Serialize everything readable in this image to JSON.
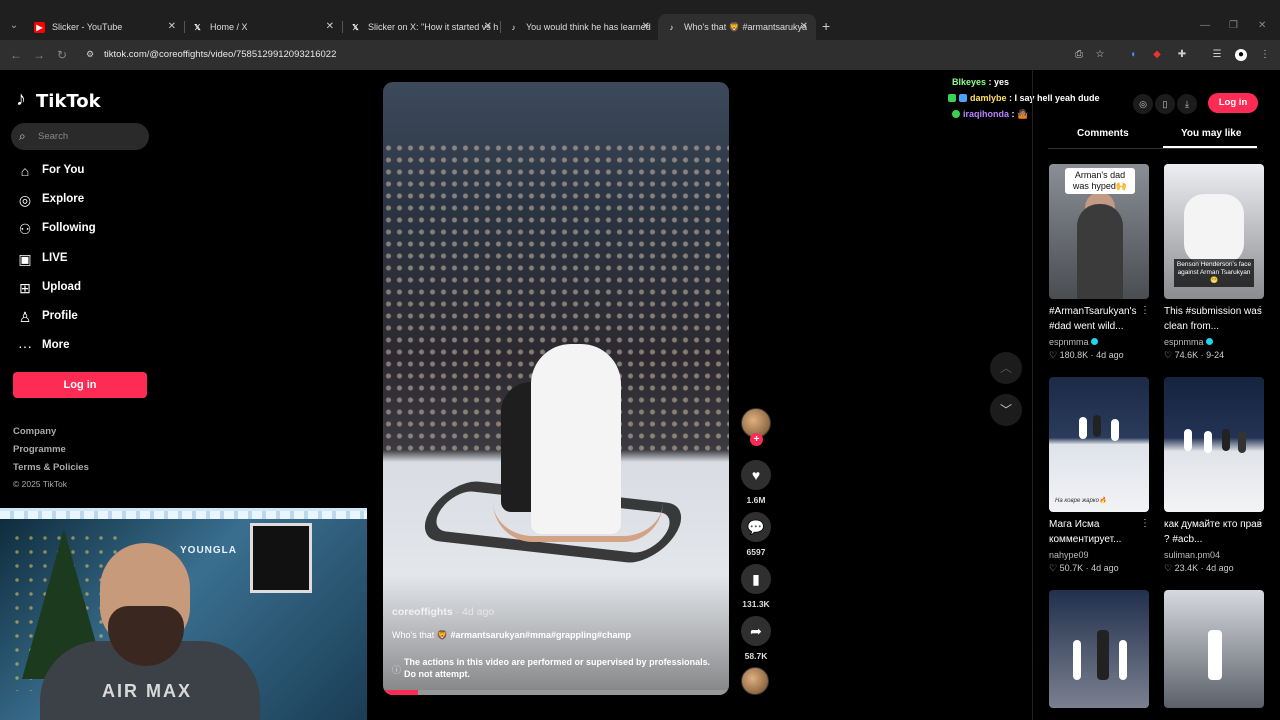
{
  "browser": {
    "tabs": [
      {
        "title": "Slicker - YouTube",
        "icon": "youtube-icon",
        "color": "#ff0000"
      },
      {
        "title": "Home / X",
        "icon": "x-icon",
        "color": "#ffffff"
      },
      {
        "title": "Slicker on X: \"How it started vs h",
        "icon": "x-icon",
        "color": "#ffffff"
      },
      {
        "title": "You would think he has learned",
        "icon": "tiktok-icon",
        "color": "#ffffff"
      },
      {
        "title": "Who's that 🦁 #armantsarukya",
        "icon": "tiktok-icon",
        "color": "#ffffff"
      }
    ],
    "active_tab": 4,
    "url": "tiktok.com/@coreoffights/video/7585129912093216022"
  },
  "tiktok": {
    "logo_text": "TikTok",
    "search_placeholder": "Search",
    "nav": [
      {
        "label": "For You",
        "icon": "home-icon",
        "glyph": "⌂"
      },
      {
        "label": "Explore",
        "icon": "compass-icon",
        "glyph": "◎"
      },
      {
        "label": "Following",
        "icon": "people-icon",
        "glyph": "⚇"
      },
      {
        "label": "LIVE",
        "icon": "live-icon",
        "glyph": "▣"
      },
      {
        "label": "Upload",
        "icon": "upload-icon",
        "glyph": "⊞"
      },
      {
        "label": "Profile",
        "icon": "profile-icon",
        "glyph": "♙"
      },
      {
        "label": "More",
        "icon": "more-icon",
        "glyph": "···"
      }
    ],
    "login_label": "Log in",
    "footer": {
      "company": "Company",
      "programme": "Programme",
      "terms": "Terms & Policies",
      "copyright": "© 2025 TikTok"
    },
    "accent": "#fe2c55"
  },
  "webcam": {
    "logo": "YOUNGLA",
    "shirt_text": "AIR MAX"
  },
  "video": {
    "author": "coreoffights",
    "age": "· 4d ago",
    "caption_prefix": "Who's that 🦁 ",
    "caption_tags": "#armantsarukyan#mma#grappling#champ",
    "warning": "The actions in this video are performed or supervised by professionals. Do not attempt.",
    "progress": 0.1,
    "likes": "1.6M",
    "comments": "6597",
    "saves": "131.3K",
    "shares": "58.7K"
  },
  "chat": [
    {
      "user": "Blkeyes",
      "message": " : yes",
      "color": "#8fff8f"
    },
    {
      "user": "damlybe",
      "message": " : I say hell yeah dude",
      "color": "#ffe066"
    },
    {
      "user": "iraqihonda",
      "message": " : 🤷🏽",
      "color": "#b583ff"
    }
  ],
  "right_panel": {
    "login_label": "Log in",
    "tab_comments": "Comments",
    "tab_you_may_like": "You may like",
    "cards": [
      {
        "thumb_label": "Arman's dad was hyped🙌",
        "title": "#ArmanTsarukyan's #dad went wild...",
        "author": "espnmma",
        "verified": true,
        "likes": "180.8K",
        "age": "4d ago"
      },
      {
        "thumb_label": "Benson Henderson's face against Arman Tsarukyan 😬",
        "title": "This #submission was clean from...",
        "author": "espnmma",
        "verified": true,
        "likes": "74.6K",
        "age": "9-24"
      },
      {
        "thumb_label": "На ковре жарко🔥",
        "title": "Мага Исма комментирует...",
        "author": "nahype09",
        "verified": false,
        "likes": "50.7K",
        "age": "4d ago"
      },
      {
        "thumb_label": "",
        "title": "как думайте кто прав ? #acb...",
        "author": "suliman.pm04",
        "verified": false,
        "likes": "23.4K",
        "age": "4d ago"
      }
    ]
  }
}
